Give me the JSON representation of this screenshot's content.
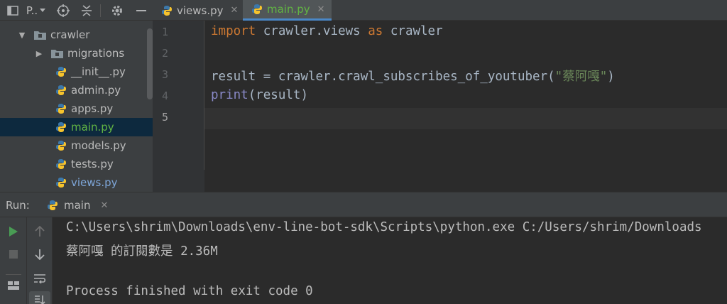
{
  "project_panel": {
    "title": "P..",
    "tree": [
      {
        "label": "crawler",
        "type": "folder",
        "expanded": true,
        "indent": 0
      },
      {
        "label": "migrations",
        "type": "folder",
        "expanded": false,
        "indent": 1
      },
      {
        "label": "__init__.py",
        "type": "python",
        "indent": 1
      },
      {
        "label": "admin.py",
        "type": "python",
        "indent": 1
      },
      {
        "label": "apps.py",
        "type": "python",
        "indent": 1
      },
      {
        "label": "main.py",
        "type": "python",
        "indent": 1,
        "selected": true
      },
      {
        "label": "models.py",
        "type": "python",
        "indent": 1
      },
      {
        "label": "tests.py",
        "type": "python",
        "indent": 1
      },
      {
        "label": "views.py",
        "type": "python",
        "indent": 1
      }
    ]
  },
  "editor_tabs": [
    {
      "label": "views.py",
      "active": false
    },
    {
      "label": "main.py",
      "active": true
    }
  ],
  "editor": {
    "line_numbers": [
      "1",
      "2",
      "3",
      "4",
      "5"
    ],
    "current_line": "5",
    "code": {
      "l1_kw_import": "import",
      "l1_module": " crawler.views ",
      "l1_kw_as": "as",
      "l1_alias": " crawler",
      "l3_prefix": "result = crawler.crawl_subscribes_of_youtuber(",
      "l3_string": "\"蔡阿嘎\"",
      "l3_suffix": ")",
      "l4_builtin": "print",
      "l4_rest": "(result)"
    }
  },
  "run_panel": {
    "label": "Run:",
    "tab_label": "main",
    "console": [
      "C:\\Users\\shrim\\Downloads\\env-line-bot-sdk\\Scripts\\python.exe C:/Users/shrim/Downloads",
      "蔡阿嘎 的訂閱數是 2.36M",
      "",
      "Process finished with exit code 0"
    ]
  },
  "colors": {
    "keyword": "#cc7832",
    "string": "#6a8759",
    "builtin": "#8888c6",
    "active_file": "#62b543",
    "modified_file": "#7ea6d8",
    "run_green": "#499c54"
  }
}
